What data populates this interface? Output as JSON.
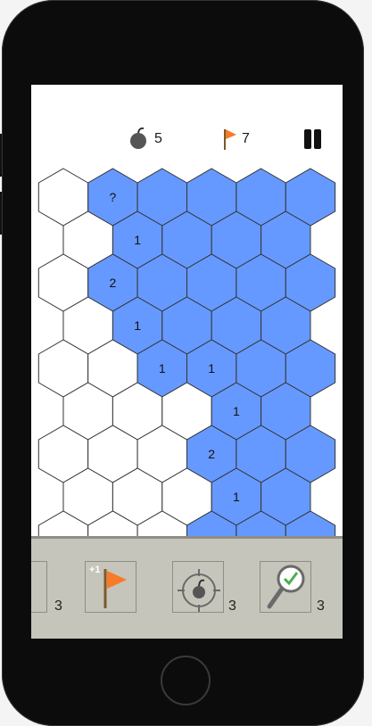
{
  "hud": {
    "bomb_count": "5",
    "flag_count": "7",
    "bomb_icon": "bomb-icon",
    "flag_icon": "flag-icon",
    "pause_icon": "pause-icon"
  },
  "colors": {
    "covered": "#6699ff",
    "revealed": "#ffffff",
    "toolbar": "#c6c5bb",
    "flag": "#f77b2a"
  },
  "board": {
    "rows": [
      [
        "",
        "?",
        "",
        "",
        "",
        ""
      ],
      [
        "",
        "1",
        "",
        "",
        ""
      ],
      [
        "",
        "2",
        "",
        "",
        "",
        ""
      ],
      [
        "",
        "1",
        "",
        "",
        ""
      ],
      [
        "",
        "",
        "1",
        "1",
        "",
        ""
      ],
      [
        "",
        "",
        "",
        "1",
        ""
      ],
      [
        "",
        "",
        "",
        "2",
        "",
        ""
      ],
      [
        "",
        "",
        "",
        "1",
        ""
      ],
      [
        "",
        "",
        "",
        "",
        "",
        ""
      ]
    ],
    "covered": [
      [
        false,
        true,
        true,
        true,
        true,
        true
      ],
      [
        false,
        true,
        true,
        true,
        true
      ],
      [
        false,
        true,
        true,
        true,
        true,
        true
      ],
      [
        false,
        true,
        true,
        true,
        true
      ],
      [
        false,
        false,
        true,
        true,
        true,
        true
      ],
      [
        false,
        false,
        false,
        true,
        true
      ],
      [
        false,
        false,
        false,
        true,
        true,
        true
      ],
      [
        false,
        false,
        false,
        true,
        true
      ],
      [
        false,
        false,
        false,
        true,
        true,
        true
      ]
    ]
  },
  "toolbar": {
    "tools": [
      {
        "name": "partial-tool",
        "icon": "tool-icon",
        "count": "3"
      },
      {
        "name": "add-flag-tool",
        "icon": "flag-plus-icon",
        "badge": "+1",
        "count": ""
      },
      {
        "name": "bomb-target-tool",
        "icon": "bomb-target-icon",
        "count": "3"
      },
      {
        "name": "inspect-tool",
        "icon": "magnifier-check-icon",
        "count": "3"
      }
    ]
  }
}
